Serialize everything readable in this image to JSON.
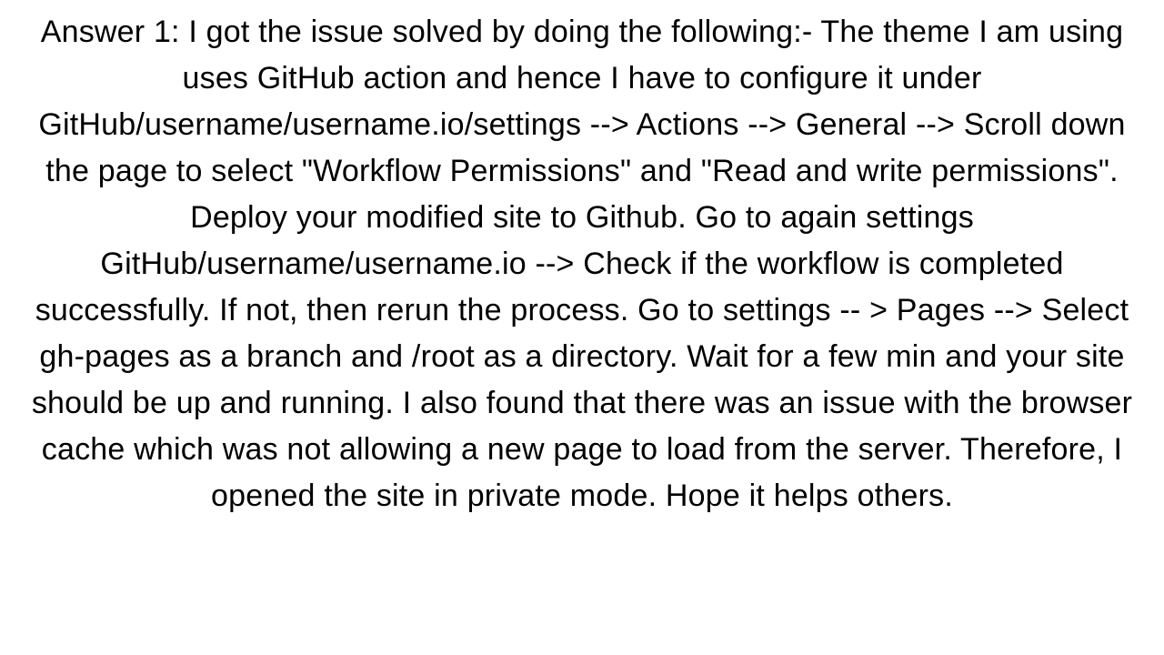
{
  "answer": {
    "text": "Answer 1: I got the issue solved by doing the following:- The theme I am using uses GitHub action and hence I have to configure it under GitHub/username/username.io/settings --> Actions --> General --> Scroll down the page to select \"Workflow Permissions\" and \"Read and write permissions\". Deploy your modified site to Github. Go to again settings GitHub/username/username.io --> Check if the workflow is completed successfully. If not, then rerun the process. Go to settings -- > Pages --> Select gh-pages as a branch and /root as a directory. Wait for a few min and your site should be up and running.  I also found that there was an issue with the browser cache which was not allowing a new page to load from the server. Therefore, I opened the site in private mode. Hope it helps others."
  }
}
